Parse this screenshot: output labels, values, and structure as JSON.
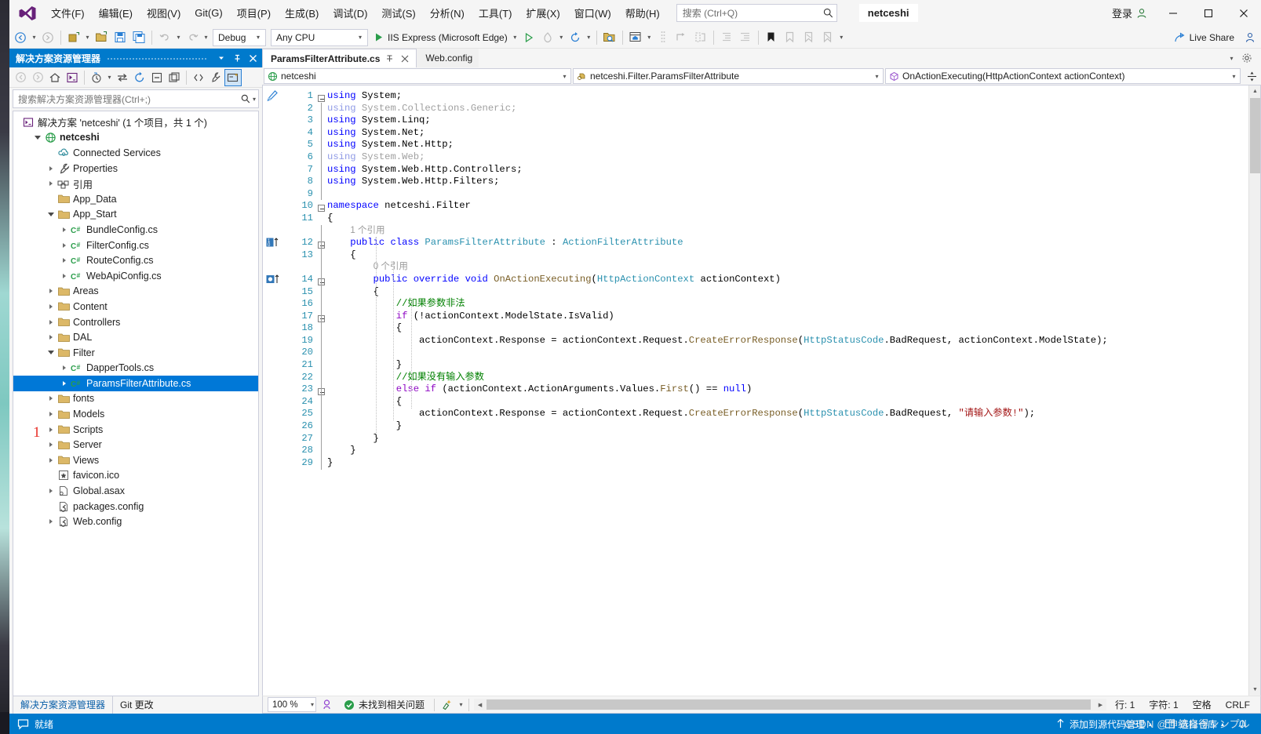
{
  "window": {
    "title": "netceshi",
    "signin_label": "登录",
    "minimize": "minimize-icon",
    "maximize": "maximize-icon",
    "close": "close-icon"
  },
  "menubar": {
    "items": [
      {
        "label": "文件(F)",
        "name": "menu-file"
      },
      {
        "label": "编辑(E)",
        "name": "menu-edit"
      },
      {
        "label": "视图(V)",
        "name": "menu-view"
      },
      {
        "label": "Git(G)",
        "name": "menu-git"
      },
      {
        "label": "项目(P)",
        "name": "menu-project"
      },
      {
        "label": "生成(B)",
        "name": "menu-build"
      },
      {
        "label": "调试(D)",
        "name": "menu-debug"
      },
      {
        "label": "测试(S)",
        "name": "menu-test"
      },
      {
        "label": "分析(N)",
        "name": "menu-analyze"
      },
      {
        "label": "工具(T)",
        "name": "menu-tools"
      },
      {
        "label": "扩展(X)",
        "name": "menu-extensions"
      },
      {
        "label": "窗口(W)",
        "name": "menu-window"
      },
      {
        "label": "帮助(H)",
        "name": "menu-help"
      }
    ],
    "search_placeholder": "搜索 (Ctrl+Q)"
  },
  "toolbar": {
    "configuration": "Debug",
    "platform": "Any CPU",
    "run_target": "IIS Express (Microsoft Edge)",
    "live_share": "Live Share"
  },
  "solution_explorer": {
    "title": "解决方案资源管理器",
    "search_placeholder": "搜索解决方案资源管理器(Ctrl+;)",
    "solution_label": "解决方案 'netceshi' (1 个项目，共 1 个)",
    "tabs": [
      {
        "label": "解决方案资源管理器",
        "active": true
      },
      {
        "label": "Git 更改",
        "active": false
      }
    ],
    "annotation": "1",
    "tree": [
      {
        "label": "netceshi",
        "indent": 1,
        "icon": "project-icon",
        "twisty": "open",
        "bold": true,
        "selected": false
      },
      {
        "label": "Connected Services",
        "indent": 2,
        "icon": "cloud-icon",
        "twisty": "none",
        "bold": false,
        "selected": false
      },
      {
        "label": "Properties",
        "indent": 2,
        "icon": "wrench-icon",
        "twisty": "closed",
        "bold": false,
        "selected": false
      },
      {
        "label": "引用",
        "indent": 2,
        "icon": "references-icon",
        "twisty": "closed",
        "bold": false,
        "selected": false
      },
      {
        "label": "App_Data",
        "indent": 2,
        "icon": "folder-icon",
        "twisty": "none",
        "bold": false,
        "selected": false
      },
      {
        "label": "App_Start",
        "indent": 2,
        "icon": "folder-icon",
        "twisty": "open",
        "bold": false,
        "selected": false
      },
      {
        "label": "BundleConfig.cs",
        "indent": 3,
        "icon": "csharp-icon",
        "twisty": "closed",
        "bold": false,
        "selected": false
      },
      {
        "label": "FilterConfig.cs",
        "indent": 3,
        "icon": "csharp-icon",
        "twisty": "closed",
        "bold": false,
        "selected": false
      },
      {
        "label": "RouteConfig.cs",
        "indent": 3,
        "icon": "csharp-icon",
        "twisty": "closed",
        "bold": false,
        "selected": false
      },
      {
        "label": "WebApiConfig.cs",
        "indent": 3,
        "icon": "csharp-icon",
        "twisty": "closed",
        "bold": false,
        "selected": false
      },
      {
        "label": "Areas",
        "indent": 2,
        "icon": "folder-icon",
        "twisty": "closed",
        "bold": false,
        "selected": false
      },
      {
        "label": "Content",
        "indent": 2,
        "icon": "folder-icon",
        "twisty": "closed",
        "bold": false,
        "selected": false
      },
      {
        "label": "Controllers",
        "indent": 2,
        "icon": "folder-icon",
        "twisty": "closed",
        "bold": false,
        "selected": false
      },
      {
        "label": "DAL",
        "indent": 2,
        "icon": "folder-icon",
        "twisty": "closed",
        "bold": false,
        "selected": false
      },
      {
        "label": "Filter",
        "indent": 2,
        "icon": "folder-icon",
        "twisty": "open",
        "bold": false,
        "selected": false
      },
      {
        "label": "DapperTools.cs",
        "indent": 3,
        "icon": "csharp-icon",
        "twisty": "closed",
        "bold": false,
        "selected": false
      },
      {
        "label": "ParamsFilterAttribute.cs",
        "indent": 3,
        "icon": "csharp-icon",
        "twisty": "closed",
        "bold": false,
        "selected": true
      },
      {
        "label": "fonts",
        "indent": 2,
        "icon": "folder-icon",
        "twisty": "closed",
        "bold": false,
        "selected": false
      },
      {
        "label": "Models",
        "indent": 2,
        "icon": "folder-icon",
        "twisty": "closed",
        "bold": false,
        "selected": false
      },
      {
        "label": "Scripts",
        "indent": 2,
        "icon": "folder-icon",
        "twisty": "closed",
        "bold": false,
        "selected": false
      },
      {
        "label": "Server",
        "indent": 2,
        "icon": "folder-icon",
        "twisty": "closed",
        "bold": false,
        "selected": false
      },
      {
        "label": "Views",
        "indent": 2,
        "icon": "folder-icon",
        "twisty": "closed",
        "bold": false,
        "selected": false
      },
      {
        "label": "favicon.ico",
        "indent": 2,
        "icon": "image-icon",
        "twisty": "none",
        "bold": false,
        "selected": false
      },
      {
        "label": "Global.asax",
        "indent": 2,
        "icon": "asax-icon",
        "twisty": "closed",
        "bold": false,
        "selected": false
      },
      {
        "label": "packages.config",
        "indent": 2,
        "icon": "config-icon",
        "twisty": "none",
        "bold": false,
        "selected": false
      },
      {
        "label": "Web.config",
        "indent": 2,
        "icon": "config-icon",
        "twisty": "closed",
        "bold": false,
        "selected": false
      }
    ]
  },
  "editor": {
    "tabs": [
      {
        "label": "ParamsFilterAttribute.cs",
        "active": true
      },
      {
        "label": "Web.config",
        "active": false
      }
    ],
    "navbar": {
      "project": "netceshi",
      "type": "netceshi.Filter.ParamsFilterAttribute",
      "member": "OnActionExecuting(HttpActionContext actionContext)"
    },
    "status": {
      "zoom": "100 %",
      "problems": "未找到相关问题",
      "line_label": "行: 1",
      "char_label": "字符: 1",
      "spaces": "空格",
      "eol": "CRLF"
    },
    "code_lines": [
      {
        "n": 1,
        "text": "using System;"
      },
      {
        "n": 2,
        "text": "using System.Collections.Generic;"
      },
      {
        "n": 3,
        "text": "using System.Linq;"
      },
      {
        "n": 4,
        "text": "using System.Net;"
      },
      {
        "n": 5,
        "text": "using System.Net.Http;"
      },
      {
        "n": 6,
        "text": "using System.Web;"
      },
      {
        "n": 7,
        "text": "using System.Web.Http.Controllers;"
      },
      {
        "n": 8,
        "text": "using System.Web.Http.Filters;"
      },
      {
        "n": 9,
        "text": ""
      },
      {
        "n": 10,
        "text": "namespace netceshi.Filter"
      },
      {
        "n": 11,
        "text": "{"
      },
      {
        "n": 12,
        "text": "    public class ParamsFilterAttribute : ActionFilterAttribute"
      },
      {
        "n": 13,
        "text": "    {"
      },
      {
        "n": 14,
        "text": "        public override void OnActionExecuting(HttpActionContext actionContext)"
      },
      {
        "n": 15,
        "text": "        {"
      },
      {
        "n": 16,
        "text": "            //如果参数非法"
      },
      {
        "n": 17,
        "text": "            if (!actionContext.ModelState.IsValid)"
      },
      {
        "n": 18,
        "text": "            {"
      },
      {
        "n": 19,
        "text": "                actionContext.Response = actionContext.Request.CreateErrorResponse(HttpStatusCode.BadRequest, actionContext.ModelState);"
      },
      {
        "n": 20,
        "text": ""
      },
      {
        "n": 21,
        "text": "            }"
      },
      {
        "n": 22,
        "text": "            //如果没有输入参数"
      },
      {
        "n": 23,
        "text": "            else if (actionContext.ActionArguments.Values.First() == null)"
      },
      {
        "n": 24,
        "text": "            {"
      },
      {
        "n": 25,
        "text": "                actionContext.Response = actionContext.Request.CreateErrorResponse(HttpStatusCode.BadRequest, \"请输入参数!\");"
      },
      {
        "n": 26,
        "text": "            }"
      },
      {
        "n": 27,
        "text": "        }"
      },
      {
        "n": 28,
        "text": "    }"
      },
      {
        "n": 29,
        "text": "}"
      }
    ],
    "codelens": {
      "class_refs": "1 个引用",
      "method_refs": "0 个引用"
    }
  },
  "statusbar": {
    "ready": "就绪",
    "add_source_control": "添加到源代码管理",
    "select_repo": "选择仓库",
    "overlay_text": "CSDN @伸缩自得ンンプル"
  },
  "colors": {
    "accent": "#007acc",
    "selection": "#0078d7",
    "keyword": "#0000ff",
    "type": "#2b91af",
    "comment": "#008000",
    "string": "#a31515",
    "method": "#795e26",
    "control": "#8f08c4",
    "annotation": "#e8312a"
  }
}
